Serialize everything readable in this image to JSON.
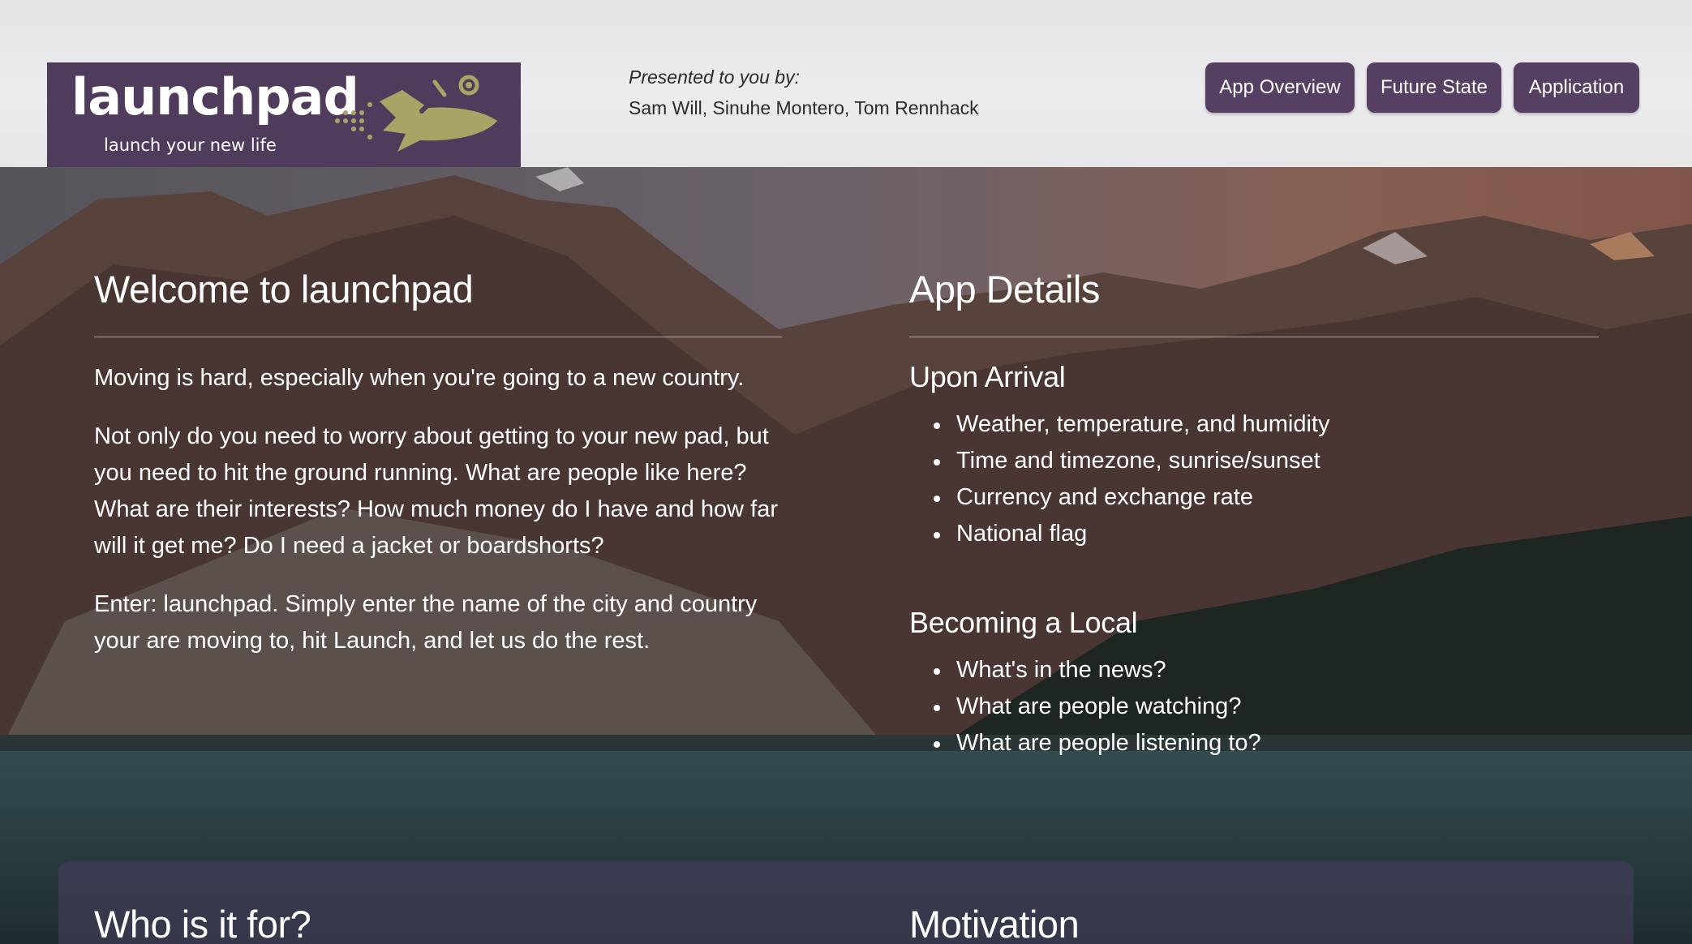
{
  "header": {
    "logo": {
      "wordmark": "launchpad",
      "tagline": "launch your new life",
      "icon": "rocket-icon"
    },
    "presented_label": "Presented to you by:",
    "authors": "Sam Will, Sinuhe Montero, Tom Rennhack",
    "nav": [
      {
        "label": "App Overview"
      },
      {
        "label": "Future State"
      },
      {
        "label": "Application"
      }
    ]
  },
  "welcome": {
    "title": "Welcome to launchpad",
    "paragraphs": [
      "Moving is hard, especially when you're going to a new country.",
      "Not only do you need to worry about getting to your new pad, but you need to hit the ground running. What are people like here? What are their interests? How much money do I have and how far will it get me? Do I need a jacket or boardshorts?",
      "Enter: launchpad. Simply enter the name of the city and country your are moving to, hit Launch, and let us do the rest."
    ]
  },
  "details": {
    "title": "App Details",
    "arrival": {
      "title": "Upon Arrival",
      "items": [
        "Weather, temperature, and humidity",
        "Time and timezone, sunrise/sunset",
        "Currency and exchange rate",
        "National flag"
      ]
    },
    "local": {
      "title": "Becoming a Local",
      "items": [
        "What's in the news?",
        "What are people watching?",
        "What are people listening to?"
      ]
    }
  },
  "lower": {
    "left_title": "Who is it for?",
    "right_title": "Motivation"
  },
  "colors": {
    "brand_purple": "#4f3c5d",
    "nav_button": "#553f62",
    "logo_accent": "#a8a466",
    "header_bg": "#e8e8ea"
  }
}
